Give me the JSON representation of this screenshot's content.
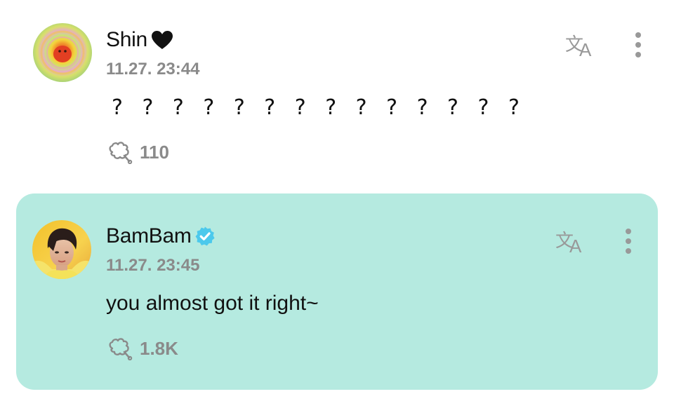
{
  "colors": {
    "highlight_background": "#b5eae0",
    "timestamp_gray": "#8a8a8a",
    "icon_gray": "#999999",
    "verified_blue": "#4cc9ec"
  },
  "comments": [
    {
      "author": "Shin",
      "author_badge_icon": "black-heart-icon",
      "timestamp": "11.27. 23:44",
      "text": "? ? ? ? ? ? ? ? ? ? ? ? ? ?",
      "likes": "110",
      "translate_icon": "translate-icon",
      "more_icon": "more-vertical-icon",
      "highlighted": false
    },
    {
      "author": "BamBam",
      "author_badge_icon": "verified-badge-icon",
      "timestamp": "11.27. 23:45",
      "text": "you almost got it right~",
      "likes": "1.8K",
      "translate_icon": "translate-icon",
      "more_icon": "more-vertical-icon",
      "highlighted": true
    }
  ]
}
